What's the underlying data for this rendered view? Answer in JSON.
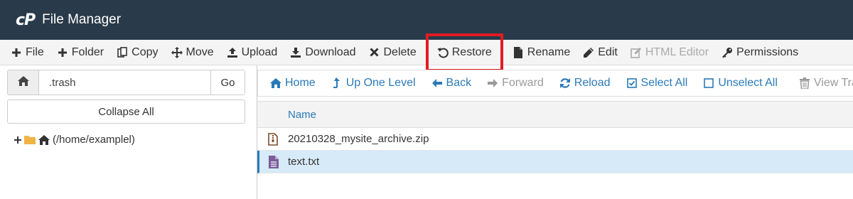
{
  "header": {
    "logo": "cP",
    "title": "File Manager"
  },
  "toolbar": {
    "file": "File",
    "folder": "Folder",
    "copy": "Copy",
    "move": "Move",
    "upload": "Upload",
    "download": "Download",
    "delete": "Delete",
    "restore": "Restore",
    "rename": "Rename",
    "edit": "Edit",
    "html_editor": "HTML Editor",
    "permissions": "Permissions"
  },
  "path": {
    "value": ".trash",
    "go": "Go"
  },
  "collapse_all": "Collapse All",
  "tree": {
    "root_label": "(/home/examplel)"
  },
  "nav": {
    "home": "Home",
    "up_one_level": "Up One Level",
    "back": "Back",
    "forward": "Forward",
    "reload": "Reload",
    "select_all": "Select All",
    "unselect_all": "Unselect All",
    "view_trash": "View Tras"
  },
  "table": {
    "column_name": "Name",
    "rows": [
      {
        "name": "20210328_mysite_archive.zip",
        "icon": "zip-file-icon",
        "selected": false
      },
      {
        "name": "text.txt",
        "icon": "text-file-icon",
        "selected": true
      }
    ]
  },
  "colors": {
    "header_bg": "#293a4a",
    "accent": "#2a7ab8",
    "highlight_box": "#e31b23",
    "selected_row": "#d6eaf8"
  }
}
